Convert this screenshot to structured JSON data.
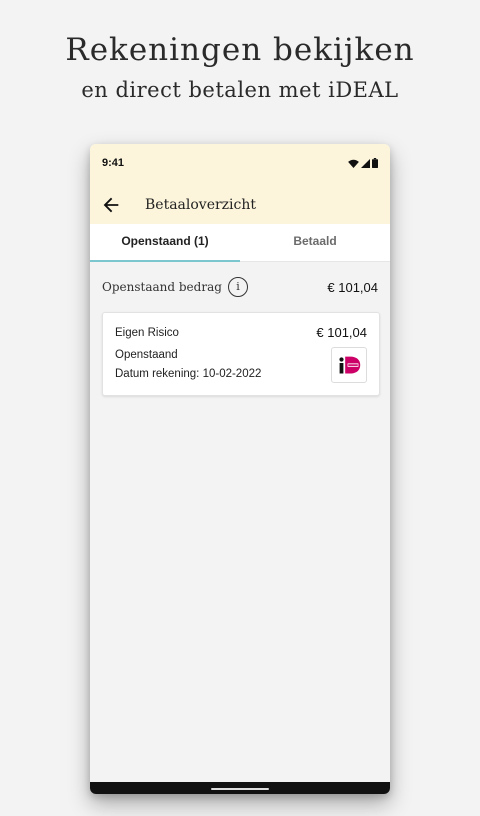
{
  "promo": {
    "title": "Rekeningen bekijken",
    "subtitle": "en direct betalen met iDEAL"
  },
  "status_bar": {
    "time": "9:41",
    "icons": [
      "wifi-icon",
      "signal-icon",
      "battery-icon"
    ]
  },
  "app_bar": {
    "title": "Betaaloverzicht",
    "back_icon": "arrow-back-icon"
  },
  "tabs": [
    {
      "label": "Openstaand (1)",
      "selected": true
    },
    {
      "label": "Betaald",
      "selected": false
    }
  ],
  "summary": {
    "label": "Openstaand bedrag",
    "info_glyph": "i",
    "amount": "€ 101,04"
  },
  "invoices": [
    {
      "title": "Eigen Risico",
      "amount": "€ 101,04",
      "status": "Openstaand",
      "date": "Datum rekening: 10-02-2022",
      "payment_method_icon": "ideal-logo"
    }
  ],
  "colors": {
    "header_background": "#fcf5dc",
    "tab_indicator": "#7cc6d0",
    "content_background": "#f3f3f3",
    "ideal_pink": "#cc0066"
  }
}
